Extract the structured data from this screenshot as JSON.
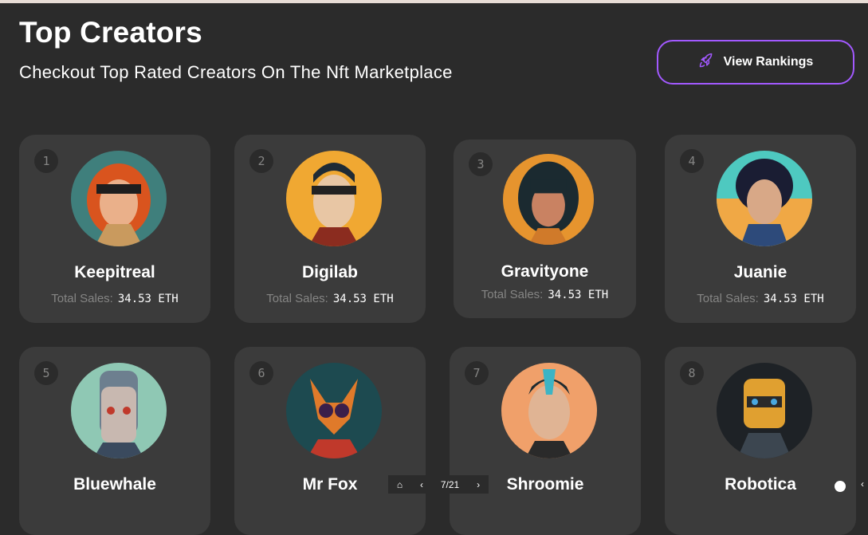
{
  "header": {
    "title": "Top Creators",
    "subtitle": "Checkout Top Rated Creators On The Nft Marketplace",
    "button_label": "View Rankings",
    "button_icon": "rocket-icon",
    "accent_color": "#a259ff"
  },
  "creators": [
    {
      "rank": "1",
      "name": "Keepitreal",
      "sales_label": "Total Sales:",
      "sales_value": "34.53 ETH"
    },
    {
      "rank": "2",
      "name": "Digilab",
      "sales_label": "Total Sales:",
      "sales_value": "34.53 ETH"
    },
    {
      "rank": "3",
      "name": "Gravityone",
      "sales_label": "Total Sales:",
      "sales_value": "34.53 ETH"
    },
    {
      "rank": "4",
      "name": "Juanie",
      "sales_label": "Total Sales:",
      "sales_value": "34.53 ETH"
    },
    {
      "rank": "5",
      "name": "Bluewhale"
    },
    {
      "rank": "6",
      "name": "Mr Fox"
    },
    {
      "rank": "7",
      "name": "Shroomie"
    },
    {
      "rank": "8",
      "name": "Robotica"
    }
  ],
  "pager": {
    "home_icon": "home-icon",
    "prev_icon": "chevron-left-icon",
    "page_text": "7/21",
    "next_icon": "chevron-right-icon"
  }
}
